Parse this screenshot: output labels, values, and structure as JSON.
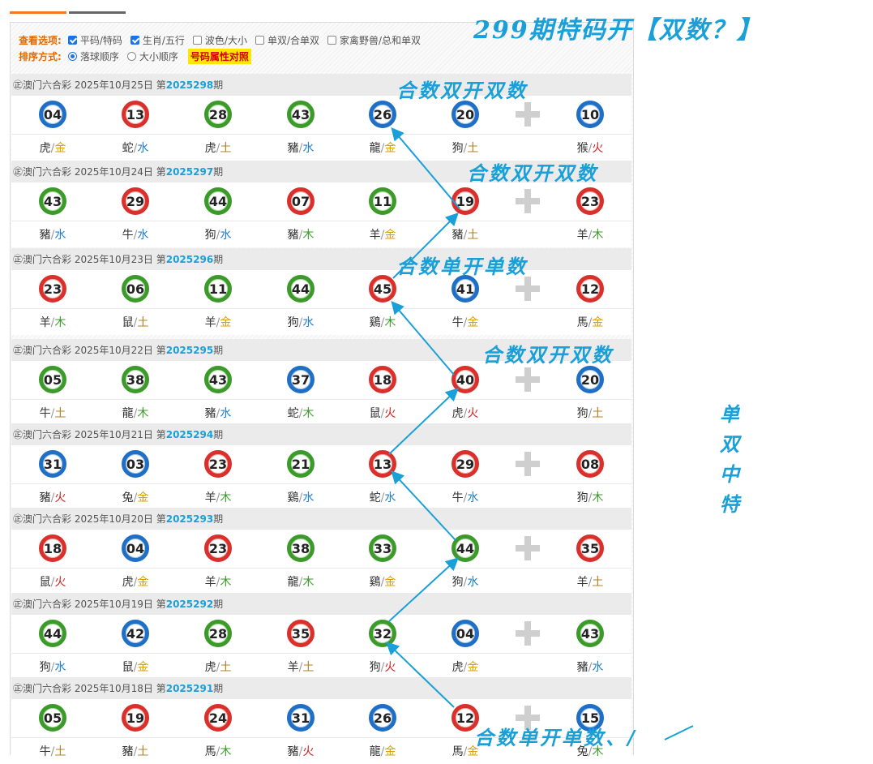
{
  "options": {
    "view_label": "查看选项:",
    "view_items": [
      {
        "label": "平码/特码",
        "checked": true
      },
      {
        "label": "生肖/五行",
        "checked": true
      },
      {
        "label": "波色/大小",
        "checked": false
      },
      {
        "label": "单双/合单双",
        "checked": false
      },
      {
        "label": "家禽野兽/总和单双",
        "checked": false
      }
    ],
    "sort_label": "排序方式:",
    "sort_items": [
      {
        "label": "落球顺序",
        "selected": true
      },
      {
        "label": "大小顺序",
        "selected": false
      }
    ],
    "attr_button": "号码属性对照"
  },
  "draws": [
    {
      "prefix": "㊣澳门六合彩 2025年10月25日 第",
      "issue": "2025298",
      "suffix": "期",
      "balls": [
        [
          "04",
          "blue"
        ],
        [
          "13",
          "red"
        ],
        [
          "28",
          "green"
        ],
        [
          "43",
          "green"
        ],
        [
          "26",
          "blue"
        ],
        [
          "20",
          "blue"
        ],
        [
          "10",
          "blue"
        ]
      ],
      "labels": [
        [
          "虎",
          "金",
          "gold"
        ],
        [
          "蛇",
          "水",
          "water"
        ],
        [
          "虎",
          "土",
          "earth"
        ],
        [
          "豬",
          "水",
          "water"
        ],
        [
          "龍",
          "金",
          "gold"
        ],
        [
          "狗",
          "土",
          "earth"
        ],
        [
          "猴",
          "火",
          "fire"
        ]
      ]
    },
    {
      "prefix": "㊣澳门六合彩 2025年10月24日 第",
      "issue": "2025297",
      "suffix": "期",
      "balls": [
        [
          "43",
          "green"
        ],
        [
          "29",
          "red"
        ],
        [
          "44",
          "green"
        ],
        [
          "07",
          "red"
        ],
        [
          "11",
          "green"
        ],
        [
          "19",
          "red"
        ],
        [
          "23",
          "red"
        ]
      ],
      "labels": [
        [
          "豬",
          "水",
          "water"
        ],
        [
          "牛",
          "水",
          "water"
        ],
        [
          "狗",
          "水",
          "water"
        ],
        [
          "豬",
          "木",
          "wood"
        ],
        [
          "羊",
          "金",
          "gold"
        ],
        [
          "豬",
          "土",
          "earth"
        ],
        [
          "羊",
          "木",
          "wood"
        ]
      ]
    },
    {
      "prefix": "㊣澳门六合彩 2025年10月23日 第",
      "issue": "2025296",
      "suffix": "期",
      "balls": [
        [
          "23",
          "red"
        ],
        [
          "06",
          "green"
        ],
        [
          "11",
          "green"
        ],
        [
          "44",
          "green"
        ],
        [
          "45",
          "red"
        ],
        [
          "41",
          "blue"
        ],
        [
          "12",
          "red"
        ]
      ],
      "labels": [
        [
          "羊",
          "木",
          "wood"
        ],
        [
          "鼠",
          "土",
          "earth"
        ],
        [
          "羊",
          "金",
          "gold"
        ],
        [
          "狗",
          "水",
          "water"
        ],
        [
          "鷄",
          "木",
          "wood"
        ],
        [
          "牛",
          "金",
          "gold"
        ],
        [
          "馬",
          "金",
          "gold"
        ]
      ]
    },
    {
      "prefix": "㊣澳门六合彩 2025年10月22日 第",
      "issue": "2025295",
      "suffix": "期",
      "balls": [
        [
          "05",
          "green"
        ],
        [
          "38",
          "green"
        ],
        [
          "43",
          "green"
        ],
        [
          "37",
          "blue"
        ],
        [
          "18",
          "red"
        ],
        [
          "40",
          "red"
        ],
        [
          "20",
          "blue"
        ]
      ],
      "labels": [
        [
          "牛",
          "土",
          "earth"
        ],
        [
          "龍",
          "木",
          "wood"
        ],
        [
          "豬",
          "水",
          "water"
        ],
        [
          "蛇",
          "木",
          "wood"
        ],
        [
          "鼠",
          "火",
          "fire"
        ],
        [
          "虎",
          "火",
          "fire"
        ],
        [
          "狗",
          "土",
          "earth"
        ]
      ]
    },
    {
      "prefix": "㊣澳门六合彩 2025年10月21日 第",
      "issue": "2025294",
      "suffix": "期",
      "balls": [
        [
          "31",
          "blue"
        ],
        [
          "03",
          "blue"
        ],
        [
          "23",
          "red"
        ],
        [
          "21",
          "green"
        ],
        [
          "13",
          "red"
        ],
        [
          "29",
          "red"
        ],
        [
          "08",
          "red"
        ]
      ],
      "labels": [
        [
          "豬",
          "火",
          "fire"
        ],
        [
          "兔",
          "金",
          "gold"
        ],
        [
          "羊",
          "木",
          "wood"
        ],
        [
          "鷄",
          "水",
          "water"
        ],
        [
          "蛇",
          "水",
          "water"
        ],
        [
          "牛",
          "水",
          "water"
        ],
        [
          "狗",
          "木",
          "wood"
        ]
      ]
    },
    {
      "prefix": "㊣澳门六合彩 2025年10月20日 第",
      "issue": "2025293",
      "suffix": "期",
      "balls": [
        [
          "18",
          "red"
        ],
        [
          "04",
          "blue"
        ],
        [
          "23",
          "red"
        ],
        [
          "38",
          "green"
        ],
        [
          "33",
          "green"
        ],
        [
          "44",
          "green"
        ],
        [
          "35",
          "red"
        ]
      ],
      "labels": [
        [
          "鼠",
          "火",
          "fire"
        ],
        [
          "虎",
          "金",
          "gold"
        ],
        [
          "羊",
          "木",
          "wood"
        ],
        [
          "龍",
          "木",
          "wood"
        ],
        [
          "鷄",
          "金",
          "gold"
        ],
        [
          "狗",
          "水",
          "water"
        ],
        [
          "羊",
          "土",
          "earth"
        ]
      ]
    },
    {
      "prefix": "㊣澳门六合彩 2025年10月19日 第",
      "issue": "2025292",
      "suffix": "期",
      "balls": [
        [
          "44",
          "green"
        ],
        [
          "42",
          "blue"
        ],
        [
          "28",
          "green"
        ],
        [
          "35",
          "red"
        ],
        [
          "32",
          "green"
        ],
        [
          "04",
          "blue"
        ],
        [
          "43",
          "green"
        ]
      ],
      "labels": [
        [
          "狗",
          "水",
          "water"
        ],
        [
          "鼠",
          "金",
          "gold"
        ],
        [
          "虎",
          "土",
          "earth"
        ],
        [
          "羊",
          "土",
          "earth"
        ],
        [
          "狗",
          "火",
          "fire"
        ],
        [
          "虎",
          "金",
          "gold"
        ],
        [
          "豬",
          "水",
          "water"
        ]
      ]
    },
    {
      "prefix": "㊣澳门六合彩 2025年10月18日 第",
      "issue": "2025291",
      "suffix": "期",
      "balls": [
        [
          "05",
          "green"
        ],
        [
          "19",
          "red"
        ],
        [
          "24",
          "red"
        ],
        [
          "31",
          "blue"
        ],
        [
          "26",
          "blue"
        ],
        [
          "12",
          "red"
        ],
        [
          "15",
          "blue"
        ]
      ],
      "labels": [
        [
          "牛",
          "土",
          "earth"
        ],
        [
          "豬",
          "土",
          "earth"
        ],
        [
          "馬",
          "木",
          "wood"
        ],
        [
          "豬",
          "火",
          "fire"
        ],
        [
          "龍",
          "金",
          "gold"
        ],
        [
          "馬",
          "金",
          "gold"
        ],
        [
          "兔",
          "木",
          "wood"
        ]
      ]
    }
  ],
  "annotations": {
    "title": "299期特码开【双数？】",
    "notes": [
      "合数双开双数",
      "合数双开双数",
      "合数单开单数",
      "合数双开双数",
      "合数单开单数、/"
    ],
    "vertical": [
      "单",
      "双",
      "中",
      "特"
    ]
  }
}
